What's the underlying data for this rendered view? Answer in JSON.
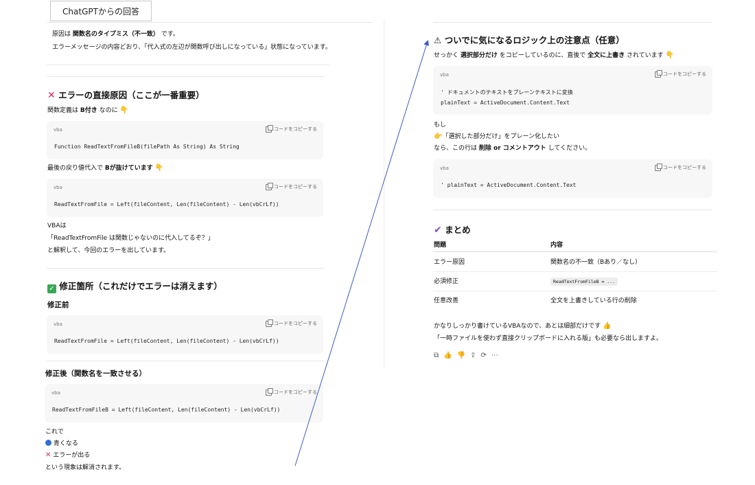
{
  "header": {
    "tag": "ChatGPTからの回答"
  },
  "left": {
    "intro_line1_pre": "原因は ",
    "intro_line1_bold": "関数名のタイプミス（不一致）",
    "intro_line1_post": " です。",
    "intro_line2": "エラーメッセージの内容どおり、「代入式の左辺が関数呼び出しになっている」状態になっています。",
    "sec1_title": "エラーの直接原因（ここが一番重要）",
    "sec1_line_pre": "関数定義は ",
    "sec1_line_bold": "B付き",
    "sec1_line_post": " なのに",
    "code1_lang": "vba",
    "code1_line": "Function ReadTextFromFileB(filePath As String) As String",
    "sec1_line2_pre": "最後の戻り値代入で ",
    "sec1_line2_bold": "Bが抜けています",
    "code2_lang": "vba",
    "code2_line": "ReadTextFromFile = Left(fileContent, Len(fileContent) - Len(vbCrLf))",
    "vba_line1": "VBAは",
    "vba_line2": "「ReadTextFromFile は関数じゃないのに代入してるぞ？」",
    "vba_line3": "と解釈して、今回のエラーを出しています。",
    "sec2_title": "修正箇所（これだけでエラーは消えます）",
    "before_title": "修正前",
    "code3_lang": "vba",
    "code3_line": "ReadTextFromFile = Left(fileContent, Len(fileContent) - Len(vbCrLf))",
    "after_title": "修正後（関数名を一致させる）",
    "code4_lang": "vba",
    "code4_line": "ReadTextFromFileB = Left(fileContent, Len(fileContent) - Len(vbCrLf))",
    "result_line1": "これで",
    "result_line2": "青くなる",
    "result_line3": "エラーが出る",
    "result_line4": "という現象は解消されます。"
  },
  "right": {
    "sec3_title": "ついでに気になるロジック上の注意点（任意）",
    "sec3_line_pre": "せっかく ",
    "sec3_line_bold1": "選択部分だけ",
    "sec3_line_mid": " をコピーしているのに、直後で ",
    "sec3_line_bold2": "全文に上書き",
    "sec3_line_post": " されています",
    "code5_lang": "vba",
    "code5_line1": "' ドキュメントのテキストをプレーンテキストに変換",
    "code5_line2": "plainText = ActiveDocument.Content.Text",
    "if_line1": "もし",
    "if_line2": "「選択した部分だけ」をプレーン化したい",
    "if_line3_pre": "なら、この行は ",
    "if_line3_bold": "削除 or コメントアウト",
    "if_line3_post": " してください。",
    "code6_lang": "vba",
    "code6_line": "' plainText = ActiveDocument.Content.Text",
    "sec4_title": "まとめ",
    "table": {
      "headers": [
        "問題",
        "内容"
      ],
      "rows": [
        [
          "エラー原因",
          "関数名の不一致（Bあり／なし）"
        ],
        [
          "必須修正",
          "ReadTextFromFileB = ..."
        ],
        [
          "任意改善",
          "全文を上書きしている行の削除"
        ]
      ]
    },
    "closing_line1": "かなりしっかり書けているVBAなので、あとは細部だけです",
    "closing_line2": "「一時ファイルを使わず直接クリップボードに入れる版」も必要なら出しますよ。"
  },
  "copy_label": "コードをコピーする",
  "colors": {
    "arrow": "#3b5cc4",
    "code_bg": "#f7f7f7"
  }
}
